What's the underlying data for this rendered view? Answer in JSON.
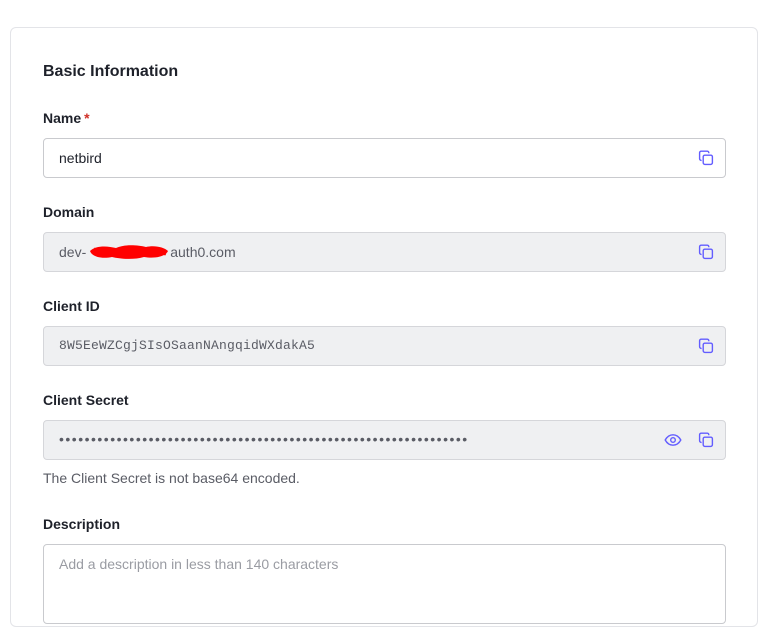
{
  "section": {
    "title": "Basic Information"
  },
  "fields": {
    "name": {
      "label": "Name",
      "required_mark": "*",
      "value": "netbird"
    },
    "domain": {
      "label": "Domain",
      "value_prefix": "dev-",
      "value_suffix": "auth0.com"
    },
    "client_id": {
      "label": "Client ID",
      "value": "8W5EeWZCgjSIsOSaanNAngqidWXdakA5"
    },
    "client_secret": {
      "label": "Client Secret",
      "masked_value": "••••••••••••••••••••••••••••••••••••••••••••••••••••••••••••••••",
      "helper_text": "The Client Secret is not base64 encoded."
    },
    "description": {
      "label": "Description",
      "placeholder": "Add a description in less than 140 characters"
    }
  },
  "icons": {
    "copy": "copy-icon",
    "reveal": "eye-icon"
  },
  "colors": {
    "icon_accent": "#635dff",
    "required": "#d03027",
    "redaction": "#ff0000"
  }
}
